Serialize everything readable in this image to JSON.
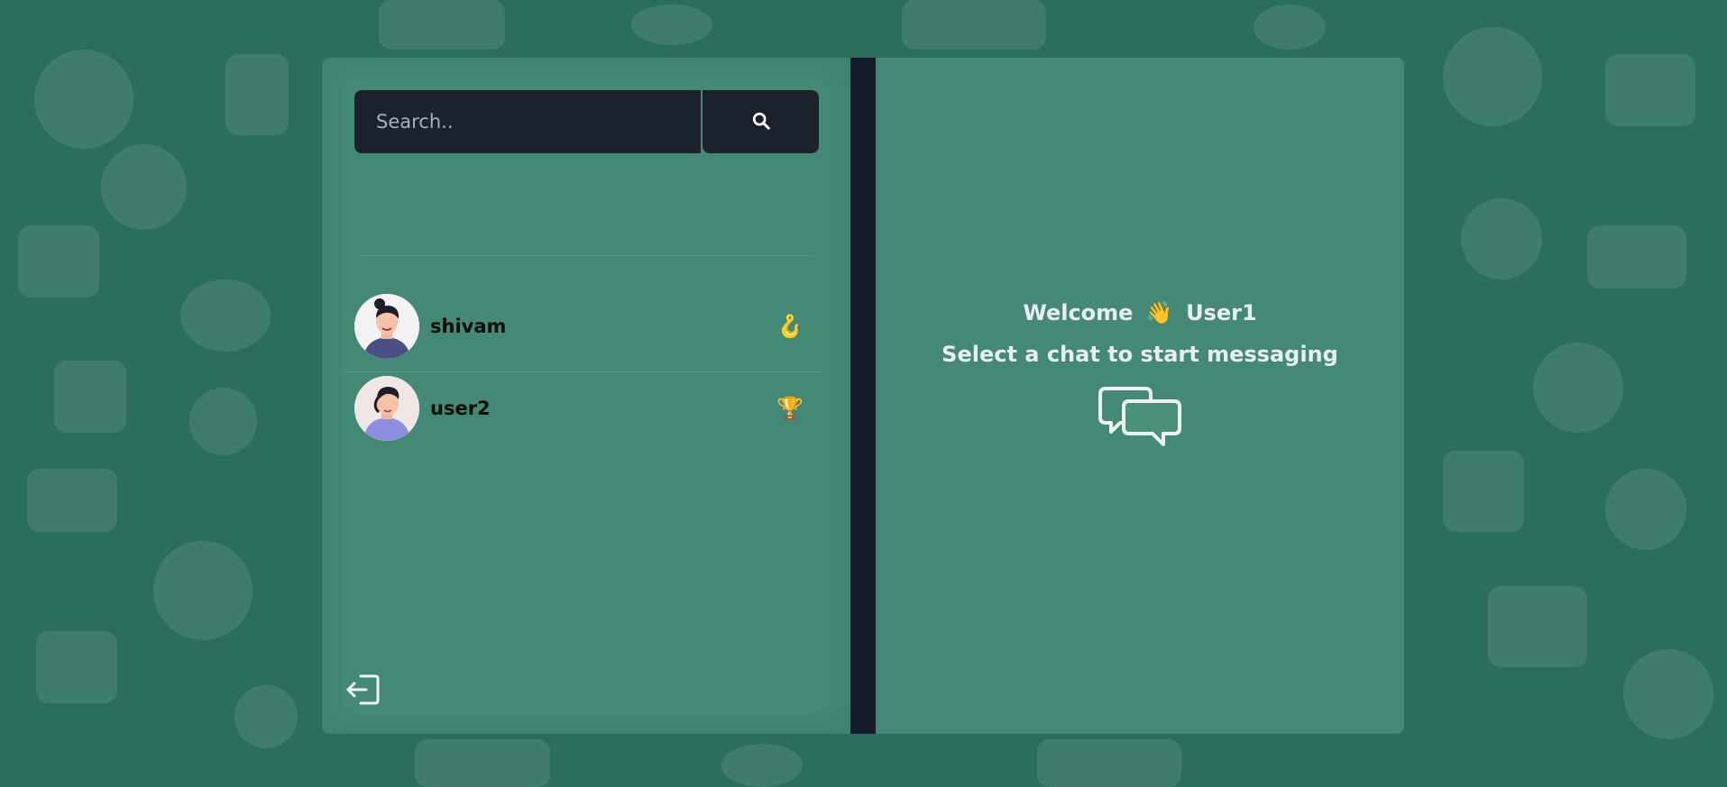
{
  "search": {
    "placeholder": "Search..",
    "button_icon": "search-icon"
  },
  "users": [
    {
      "name": "shivam",
      "emoji": "🪝",
      "avatar_icon": "man-avatar-icon"
    },
    {
      "name": "user2",
      "emoji": "🏆",
      "avatar_icon": "person-avatar-icon"
    }
  ],
  "footer": {
    "logout_icon": "logout-icon"
  },
  "welcome": {
    "greeting": "Welcome",
    "wave_emoji": "👋",
    "username": "User1",
    "prompt": "Select a chat to start messaging",
    "chat_icon": "chat-bubbles-icon"
  },
  "colors": {
    "background": "#2b6e5e",
    "panel": "#4a917c",
    "dark": "#1c222b",
    "divider": "#151c2b"
  }
}
